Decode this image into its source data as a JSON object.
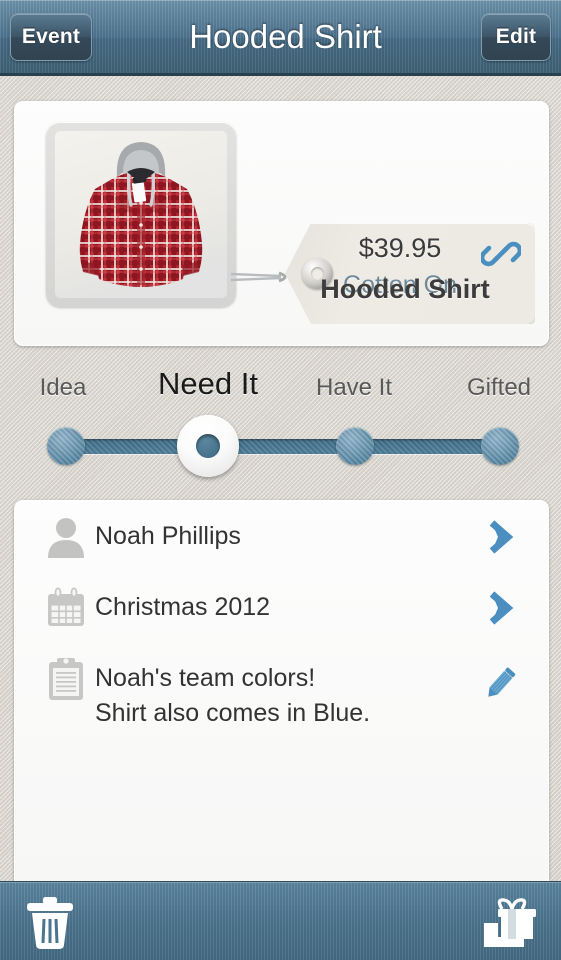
{
  "header": {
    "back_label": "Event",
    "title": "Hooded Shirt",
    "edit_label": "Edit"
  },
  "product": {
    "name": "Hooded Shirt",
    "price": "$39.95",
    "store": "Cotton On",
    "link_icon": "link-icon",
    "photo_alt": "red-plaid-hooded-shirt"
  },
  "status_slider": {
    "selected": "Need It",
    "options": [
      {
        "label": "Idea",
        "position": 12
      },
      {
        "label": "Need It",
        "position": 37
      },
      {
        "label": "Have It",
        "position": 63
      },
      {
        "label": "Gifted",
        "position": 89
      }
    ]
  },
  "details": [
    {
      "icon": "person-icon",
      "text": "Noah Phillips",
      "text2": "",
      "action_icon": "chevron-right-icon"
    },
    {
      "icon": "calendar-icon",
      "text": "Christmas 2012",
      "text2": "",
      "action_icon": "chevron-right-icon"
    },
    {
      "icon": "clipboard-icon",
      "text": "Noah's team colors!",
      "text2": "Shirt also comes in Blue.",
      "action_icon": "pencil-icon"
    }
  ],
  "toolbar": {
    "delete_icon": "trash-icon",
    "gift_icon": "gift-icon"
  },
  "colors": {
    "nav_blue": "#4e7490",
    "accent_blue": "#4a8fbf",
    "track_blue": "#45748d",
    "store_text": "#6f8b9b",
    "background": "#d8d4cd"
  }
}
